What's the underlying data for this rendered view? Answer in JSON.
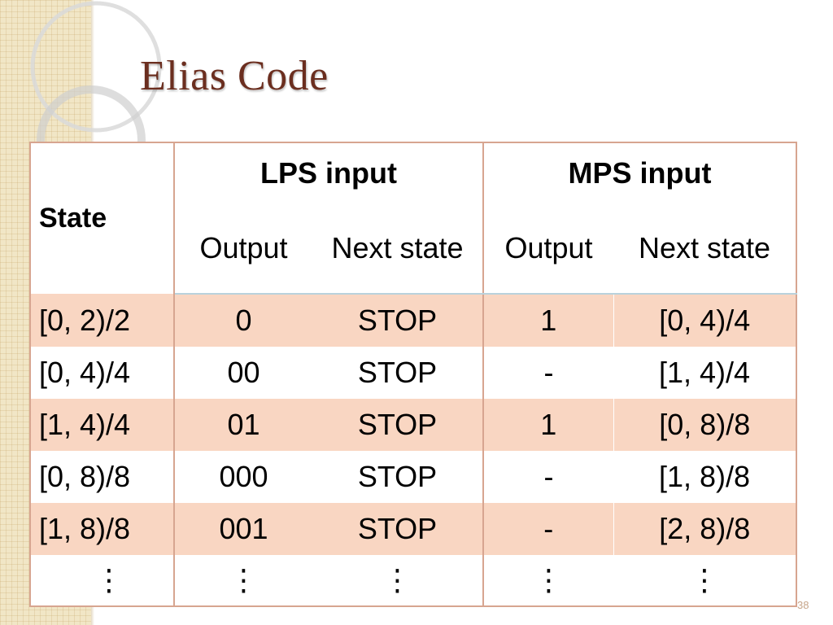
{
  "slide": {
    "title": "Elias Code",
    "number": "38"
  },
  "colors": {
    "title": "#6b2e1f",
    "row_highlight": "#f9d6c2",
    "border": "#d7a590",
    "band": "#f1e6c6"
  },
  "table": {
    "header": {
      "state": "State",
      "lps_group": "LPS input",
      "mps_group": "MPS input",
      "lps_output": "Output",
      "lps_next": "Next state",
      "mps_output": "Output",
      "mps_next": "Next state"
    },
    "rows": [
      {
        "state": "[0, 2)/2",
        "lps_output": "0",
        "lps_next": "STOP",
        "mps_output": "1",
        "mps_next": "[0, 4)/4"
      },
      {
        "state": "[0, 4)/4",
        "lps_output": "00",
        "lps_next": "STOP",
        "mps_output": "-",
        "mps_next": "[1, 4)/4"
      },
      {
        "state": "[1, 4)/4",
        "lps_output": "01",
        "lps_next": "STOP",
        "mps_output": "1",
        "mps_next": "[0, 8)/8"
      },
      {
        "state": "[0, 8)/8",
        "lps_output": "000",
        "lps_next": "STOP",
        "mps_output": "-",
        "mps_next": "[1, 8)/8"
      },
      {
        "state": "[1, 8)/8",
        "lps_output": "001",
        "lps_next": "STOP",
        "mps_output": "-",
        "mps_next": "[2, 8)/8"
      },
      {
        "state": "⋮",
        "lps_output": "⋮",
        "lps_next": "⋮",
        "mps_output": "⋮",
        "mps_next": "⋮"
      }
    ]
  }
}
